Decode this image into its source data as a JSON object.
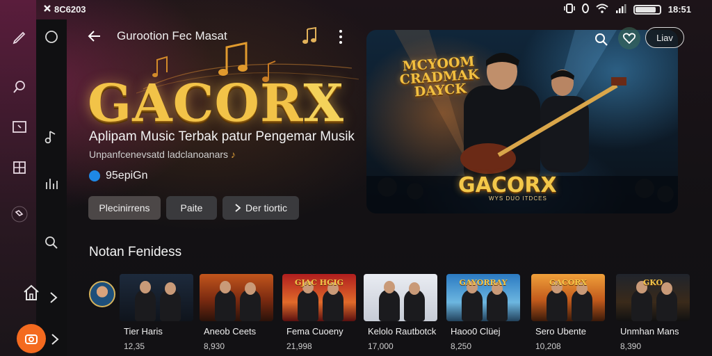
{
  "status": {
    "left_text": "8C6203",
    "time": "18:51",
    "battery_level": 0.85
  },
  "header": {
    "title": "Gurootion Fec Masat"
  },
  "hero": {
    "brand": "GACOR",
    "brand_x": "X",
    "tagline": "Aplipam Music Terbak patur Pengemar Musik",
    "subtag": "Unpanfcenevsatd ladclanoanars",
    "artist": "95epiGn"
  },
  "buttons": {
    "primary": "Plecinirrens",
    "secondary": "Paite",
    "third": "Der tiortic"
  },
  "panel": {
    "title": "MCYOOM CRADMAK DAYCK",
    "brand": "GACORX",
    "sub": "WYS DUO ITDCES",
    "live": "Liav"
  },
  "section": {
    "title": "Notan Fenidess"
  },
  "cards": [
    {
      "label": "Tier Haris",
      "count": "12,35",
      "theme": "stage-blue",
      "caption": ""
    },
    {
      "label": "Aneob Ceets",
      "count": "8,930",
      "theme": "stage-orange",
      "caption": ""
    },
    {
      "label": "Fema Cuoeny",
      "count": "21,998",
      "theme": "red-portrait",
      "caption": "GJAC HGIG"
    },
    {
      "label": "Kelolo Rautbotck",
      "count": "17,000",
      "theme": "bright-group",
      "caption": ""
    },
    {
      "label": "Haoo0 Clüej",
      "count": "8,250",
      "theme": "poster-blue",
      "caption": "GAYORRAY"
    },
    {
      "label": "Sero Ubente",
      "count": "10,208",
      "theme": "sunset",
      "caption": "GACORX"
    },
    {
      "label": "Unmhan Mans",
      "count": "8,390",
      "theme": "dark-stage",
      "caption": "GKO"
    }
  ],
  "colors": {
    "accent": "#f2c348",
    "fab": "#f46a1f",
    "sidebar": "#5a1d3c"
  },
  "icons": {
    "rail_outer": [
      "pencil-icon",
      "search-icon",
      "square-icon",
      "grid-icon",
      "tag-icon"
    ],
    "rail_inner": [
      "circle-icon",
      "music-note-icon",
      "equalizer-icon",
      "search-icon"
    ]
  }
}
